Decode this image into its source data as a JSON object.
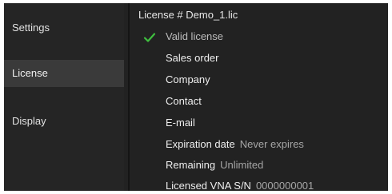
{
  "sidebar": {
    "items": [
      {
        "label": "Settings",
        "selected": false
      },
      {
        "label": "License",
        "selected": true
      },
      {
        "label": "Display",
        "selected": false
      }
    ]
  },
  "license": {
    "title": "License # Demo_1.lic",
    "status_icon": "check-icon",
    "status_icon_color": "#3fbf3f",
    "status": "Valid license",
    "fields": {
      "sales_order": {
        "label": "Sales order",
        "value": ""
      },
      "company": {
        "label": "Company",
        "value": ""
      },
      "contact": {
        "label": "Contact",
        "value": ""
      },
      "email": {
        "label": "E-mail",
        "value": ""
      },
      "expiration": {
        "label": "Expiration date",
        "value": "Never expires"
      },
      "remaining": {
        "label": "Remaining",
        "value": "Unlimited"
      },
      "serial": {
        "label": "Licensed VNA S/N",
        "value": "0000000001"
      }
    }
  }
}
